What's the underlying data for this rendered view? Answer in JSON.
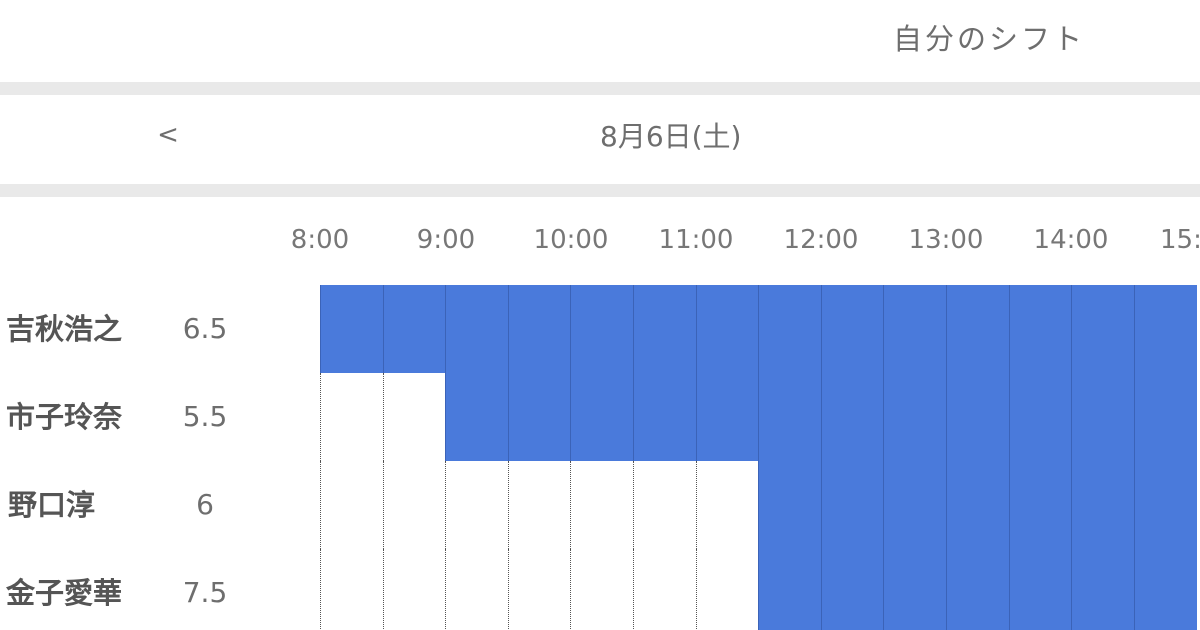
{
  "header": {
    "my_shift_label": "自分のシフト"
  },
  "date_nav": {
    "prev_label": "<",
    "date": "8月6日(土)"
  },
  "timeline": {
    "hour_labels": [
      "8:00",
      "9:00",
      "10:00",
      "11:00",
      "12:00",
      "13:00",
      "14:00",
      "15:"
    ],
    "slot_minutes": 30
  },
  "colors": {
    "shift_fill": "#4a7adb",
    "separator": "#e9e9e9",
    "text": "#6e6e6e"
  },
  "employees": [
    {
      "name": "吉秋浩之",
      "hours": "6.5",
      "slots": [
        1,
        1,
        1,
        1,
        1,
        1,
        1,
        1,
        1,
        1,
        1,
        1,
        1,
        1
      ]
    },
    {
      "name": "市子玲奈",
      "hours": "5.5",
      "slots": [
        0,
        0,
        1,
        1,
        1,
        1,
        1,
        1,
        1,
        1,
        1,
        1,
        1,
        1
      ]
    },
    {
      "name": "野口淳",
      "hours": "6",
      "slots": [
        0,
        0,
        0,
        0,
        0,
        0,
        0,
        1,
        1,
        1,
        1,
        1,
        1,
        1
      ]
    },
    {
      "name": "金子愛華",
      "hours": "7.5",
      "slots": [
        0,
        0,
        0,
        0,
        0,
        0,
        0,
        1,
        1,
        1,
        1,
        1,
        1,
        1
      ]
    }
  ]
}
